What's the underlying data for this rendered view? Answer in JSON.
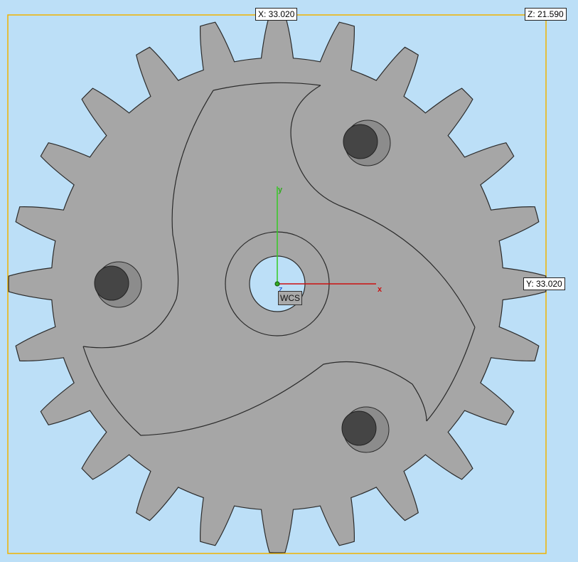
{
  "dimensions": {
    "x_label": "X: 33.020",
    "y_label": "Y: 33.020",
    "z_label": "Z: 21.590"
  },
  "wcs": {
    "label": "WCS",
    "x_axis_label": "x",
    "y_axis_label": "y",
    "z_axis_label": "z"
  },
  "colors": {
    "background": "#bcdff7",
    "bounding_box": "#f0b400",
    "part_fill": "#a6a6a6",
    "outline": "#2a2a2a",
    "peg": "#454545",
    "peg_pocket": "#8c8c8c",
    "axis_x": "#cc1111",
    "axis_y": "#33cc22",
    "origin": "#117711"
  },
  "gear": {
    "teeth": 24
  }
}
